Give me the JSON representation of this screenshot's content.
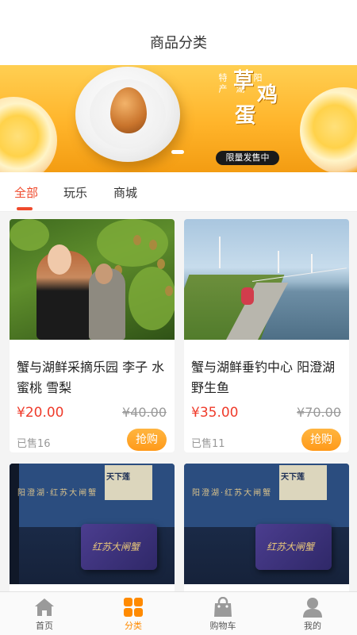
{
  "header": {
    "title": "商品分类"
  },
  "banner": {
    "subtitle_cols": [
      "阳",
      "澄湖",
      "特产"
    ],
    "title_chars": [
      "草",
      "鸡",
      "蛋",
      "蛋"
    ],
    "badge": "限量发售中",
    "active_slide": 1
  },
  "tabs": [
    {
      "label": "全部",
      "active": true
    },
    {
      "label": "玩乐",
      "active": false
    },
    {
      "label": "商城",
      "active": false
    }
  ],
  "products": [
    {
      "name": "蟹与湖鲜采摘乐园 李子 水蜜桃 雪梨",
      "price": "¥20.00",
      "original_price": "¥40.00",
      "sold": "已售16",
      "buy_label": "抢购",
      "image": "orchard"
    },
    {
      "name": "蟹与湖鲜垂钓中心 阳澄湖野生鱼",
      "price": "¥35.00",
      "original_price": "¥70.00",
      "sold": "已售11",
      "buy_label": "抢购",
      "image": "lake"
    },
    {
      "name": "",
      "image": "event",
      "image_text": {
        "card_title": "红苏大闸蟹",
        "brand": "天下莲",
        "backdrop": "阳澄湖·红苏大闸蟹"
      }
    },
    {
      "name": "",
      "image": "event",
      "image_text": {
        "card_title": "红苏大闸蟹",
        "brand": "天下莲",
        "backdrop": "阳澄湖·红苏大闸蟹"
      }
    }
  ],
  "bottom_nav": [
    {
      "label": "首页",
      "icon": "home-icon",
      "active": false
    },
    {
      "label": "分类",
      "icon": "grid-icon",
      "active": true
    },
    {
      "label": "购物车",
      "icon": "bag-icon",
      "active": false
    },
    {
      "label": "我的",
      "icon": "user-icon",
      "active": false
    }
  ],
  "colors": {
    "accent": "#ef4a2c",
    "buy_button": "#ff9a1a",
    "nav_active": "#ff8a00",
    "banner": "#ffb42a"
  }
}
